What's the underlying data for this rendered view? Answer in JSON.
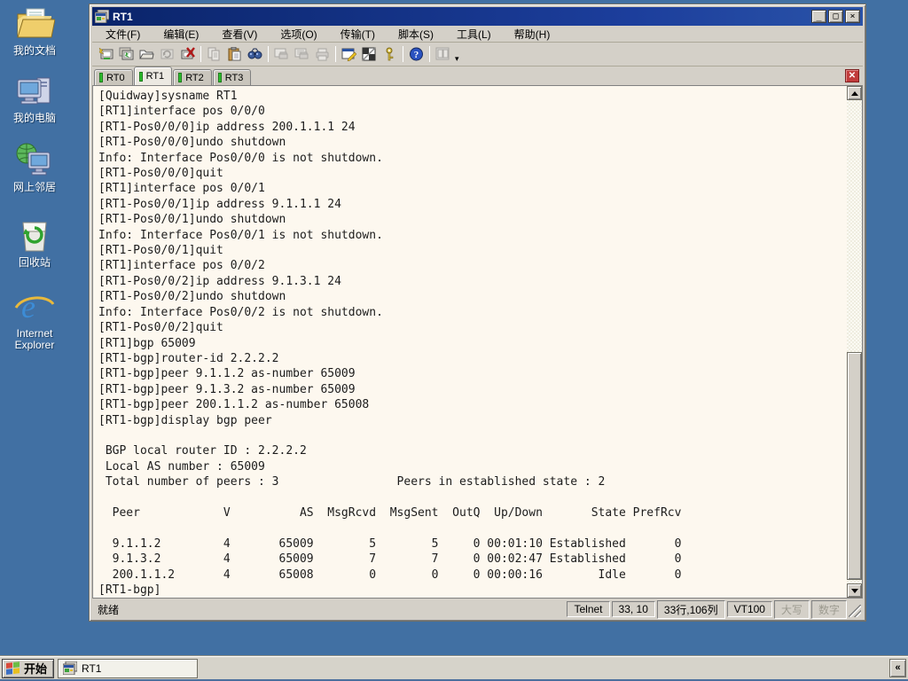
{
  "desktop": {
    "icons": [
      {
        "name": "my-documents",
        "label": "我的文档"
      },
      {
        "name": "my-computer",
        "label": "我的电脑"
      },
      {
        "name": "network-places",
        "label": "网上邻居"
      },
      {
        "name": "recycle-bin",
        "label": "回收站"
      },
      {
        "name": "internet-explorer",
        "label": "Internet\nExplorer"
      }
    ]
  },
  "window": {
    "title": "RT1",
    "controls": {
      "minimize": "_",
      "maximize": "□",
      "close": "×"
    },
    "menus": [
      {
        "label": "文件(F)"
      },
      {
        "label": "编辑(E)"
      },
      {
        "label": "查看(V)"
      },
      {
        "label": "选项(O)"
      },
      {
        "label": "传输(T)"
      },
      {
        "label": "脚本(S)"
      },
      {
        "label": "工具(L)"
      },
      {
        "label": "帮助(H)"
      }
    ],
    "toolbar": [
      {
        "icon": "quick-connect-icon",
        "enabled": true
      },
      {
        "icon": "connect-in-tab-icon",
        "enabled": true
      },
      {
        "icon": "session-manager-icon",
        "enabled": true
      },
      {
        "icon": "reconnect-icon",
        "enabled": false
      },
      {
        "icon": "disconnect-icon",
        "enabled": true
      },
      {
        "icon": "copy-icon",
        "enabled": false
      },
      {
        "icon": "paste-icon",
        "enabled": true
      },
      {
        "icon": "find-icon",
        "enabled": true
      },
      {
        "icon": "print-preview-icon",
        "enabled": false
      },
      {
        "icon": "print-selection-icon",
        "enabled": false
      },
      {
        "icon": "print-icon",
        "enabled": false
      },
      {
        "icon": "session-options-icon",
        "enabled": true
      },
      {
        "icon": "keymap-icon",
        "enabled": true
      },
      {
        "icon": "security-key-icon",
        "enabled": true
      },
      {
        "icon": "help-icon",
        "enabled": true
      },
      {
        "icon": "tile-windows-icon",
        "enabled": false
      }
    ],
    "tabs": [
      {
        "label": "RT0",
        "active": false
      },
      {
        "label": "RT1",
        "active": true
      },
      {
        "label": "RT2",
        "active": false
      },
      {
        "label": "RT3",
        "active": false
      }
    ],
    "terminal_lines": [
      "[Quidway]sysname RT1",
      "[RT1]interface pos 0/0/0",
      "[RT1-Pos0/0/0]ip address 200.1.1.1 24",
      "[RT1-Pos0/0/0]undo shutdown",
      "Info: Interface Pos0/0/0 is not shutdown.",
      "[RT1-Pos0/0/0]quit",
      "[RT1]interface pos 0/0/1",
      "[RT1-Pos0/0/1]ip address 9.1.1.1 24",
      "[RT1-Pos0/0/1]undo shutdown",
      "Info: Interface Pos0/0/1 is not shutdown.",
      "[RT1-Pos0/0/1]quit",
      "[RT1]interface pos 0/0/2",
      "[RT1-Pos0/0/2]ip address 9.1.3.1 24",
      "[RT1-Pos0/0/2]undo shutdown",
      "Info: Interface Pos0/0/2 is not shutdown.",
      "[RT1-Pos0/0/2]quit",
      "[RT1]bgp 65009",
      "[RT1-bgp]router-id 2.2.2.2",
      "[RT1-bgp]peer 9.1.1.2 as-number 65009",
      "[RT1-bgp]peer 9.1.3.2 as-number 65009",
      "[RT1-bgp]peer 200.1.1.2 as-number 65008",
      "[RT1-bgp]display bgp peer",
      "",
      " BGP local router ID : 2.2.2.2",
      " Local AS number : 65009",
      " Total number of peers : 3                 Peers in established state : 2",
      "",
      "  Peer            V          AS  MsgRcvd  MsgSent  OutQ  Up/Down       State PrefRcv",
      "",
      "  9.1.1.2         4       65009        5        5     0 00:01:10 Established       0",
      "  9.1.3.2         4       65009        7        7     0 00:02:47 Established       0",
      "  200.1.1.2       4       65008        0        0     0 00:00:16        Idle       0",
      "[RT1-bgp]"
    ],
    "bgp_summary": {
      "local_router_id": "2.2.2.2",
      "local_as": "65009",
      "total_peers": "3",
      "established_peers": "2",
      "peers": [
        {
          "peer": "9.1.1.2",
          "v": "4",
          "as": "65009",
          "msg_rcvd": "5",
          "msg_sent": "5",
          "outq": "0",
          "up_down": "00:01:10",
          "state": "Established",
          "pref_rcv": "0"
        },
        {
          "peer": "9.1.3.2",
          "v": "4",
          "as": "65009",
          "msg_rcvd": "7",
          "msg_sent": "7",
          "outq": "0",
          "up_down": "00:02:47",
          "state": "Established",
          "pref_rcv": "0"
        },
        {
          "peer": "200.1.1.2",
          "v": "4",
          "as": "65008",
          "msg_rcvd": "0",
          "msg_sent": "0",
          "outq": "0",
          "up_down": "00:00:16",
          "state": "Idle",
          "pref_rcv": "0"
        }
      ]
    },
    "statusbar": {
      "ready": "就绪",
      "protocol": "Telnet",
      "cursor_pos": "33, 10",
      "screen_size": "33行,106列",
      "emulation": "VT100",
      "caps_lock": "大写",
      "num_lock": "数字"
    }
  },
  "taskbar": {
    "start_label": "开始",
    "tasks": [
      {
        "label": "RT1"
      }
    ],
    "tray_collapse": "«"
  },
  "colors": {
    "desktop": "#4170A3",
    "titlebar": "#0A246A",
    "chrome": "#D4D0C8",
    "terminal_bg": "#FDF8EF",
    "terminal_text": "#1C1C1C",
    "tab_led": "#2FBF2F",
    "tab_close": "#C13B3B"
  }
}
